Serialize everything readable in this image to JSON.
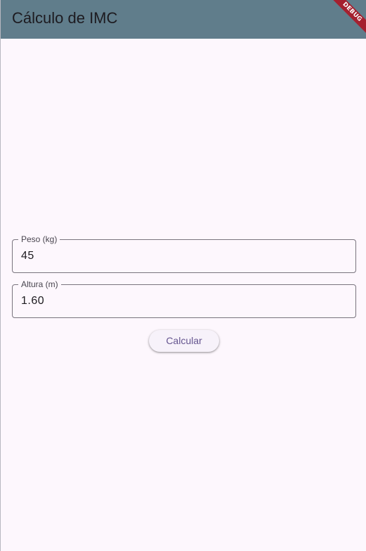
{
  "appbar": {
    "title": "Cálculo de IMC",
    "background": "#607d8b"
  },
  "debug_banner": {
    "label": "DEBUG",
    "color": "#a4202f"
  },
  "form": {
    "peso": {
      "label": "Peso (kg)",
      "value": "45"
    },
    "altura": {
      "label": "Altura (m)",
      "value": "1.60"
    },
    "calcular_label": "Calcular"
  },
  "colors": {
    "background": "#fdf7fd",
    "accent": "#65558f"
  }
}
